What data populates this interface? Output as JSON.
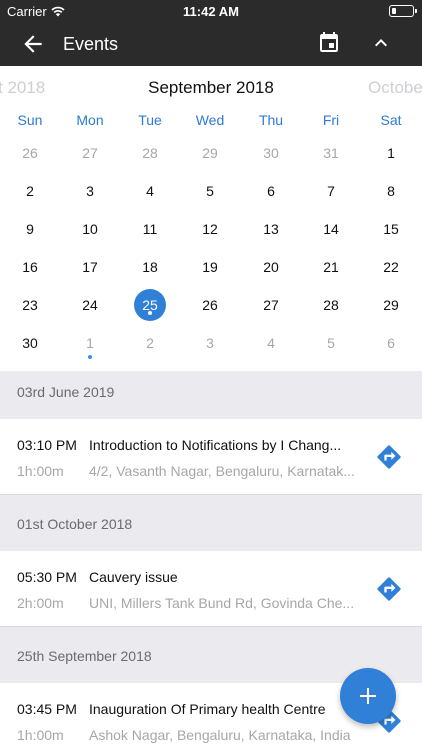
{
  "status_bar": {
    "carrier": "Carrier",
    "time": "11:42 AM"
  },
  "app_bar": {
    "title": "Events",
    "icons": [
      "back-arrow-icon",
      "calendar-icon",
      "chevron-up-icon"
    ]
  },
  "calendar": {
    "prev_month": "t 2018",
    "current_month": "September 2018",
    "next_month": "Octobe",
    "weekdays": [
      "Sun",
      "Mon",
      "Tue",
      "Wed",
      "Thu",
      "Fri",
      "Sat"
    ],
    "weeks": [
      [
        "26",
        "27",
        "28",
        "29",
        "30",
        "31",
        "1"
      ],
      [
        "2",
        "3",
        "4",
        "5",
        "6",
        "7",
        "8"
      ],
      [
        "9",
        "10",
        "11",
        "12",
        "13",
        "14",
        "15"
      ],
      [
        "16",
        "17",
        "18",
        "19",
        "20",
        "21",
        "22"
      ],
      [
        "23",
        "24",
        "25",
        "26",
        "27",
        "28",
        "29"
      ],
      [
        "30",
        "1",
        "2",
        "3",
        "4",
        "5",
        "6"
      ]
    ],
    "selected_day": "25",
    "accent_color": "#2f80d6"
  },
  "events": {
    "sections": [
      {
        "date": "03rd June 2019",
        "items": [
          {
            "time": "03:10 PM",
            "title": "Introduction to Notifications by I Chang...",
            "duration": "1h:00m",
            "location": "4/2, Vasanth Nagar, Bengaluru, Karnatak..."
          }
        ]
      },
      {
        "date": "01st October 2018",
        "items": [
          {
            "time": "05:30 PM",
            "title": "Cauvery issue",
            "duration": "2h:00m",
            "location": "UNI, Millers Tank Bund Rd, Govinda Che..."
          }
        ]
      },
      {
        "date": "25th September 2018",
        "items": [
          {
            "time": "03:45 PM",
            "title": "Inauguration Of Primary health Centre",
            "duration": "1h:00m",
            "location": "Ashok Nagar, Bengaluru, Karnataka, India"
          }
        ]
      }
    ]
  },
  "fab": {
    "icon": "plus-icon"
  }
}
